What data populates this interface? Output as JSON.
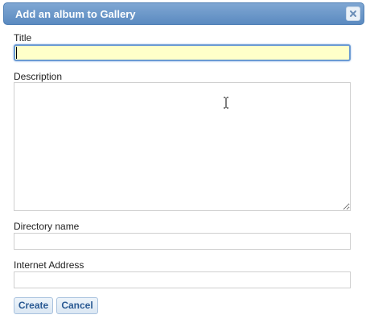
{
  "dialog": {
    "title": "Add an album to Gallery",
    "close_icon": "close-icon"
  },
  "form": {
    "title_label": "Title",
    "title_value": "",
    "description_label": "Description",
    "description_value": "",
    "directory_label": "Directory name",
    "directory_value": "",
    "internet_address_label": "Internet Address",
    "internet_address_value": ""
  },
  "buttons": {
    "create_label": "Create",
    "cancel_label": "Cancel"
  },
  "colors": {
    "titlebar": "#6a95c8",
    "focused_field_bg": "#ffffc9",
    "button_text": "#2a5a93"
  }
}
